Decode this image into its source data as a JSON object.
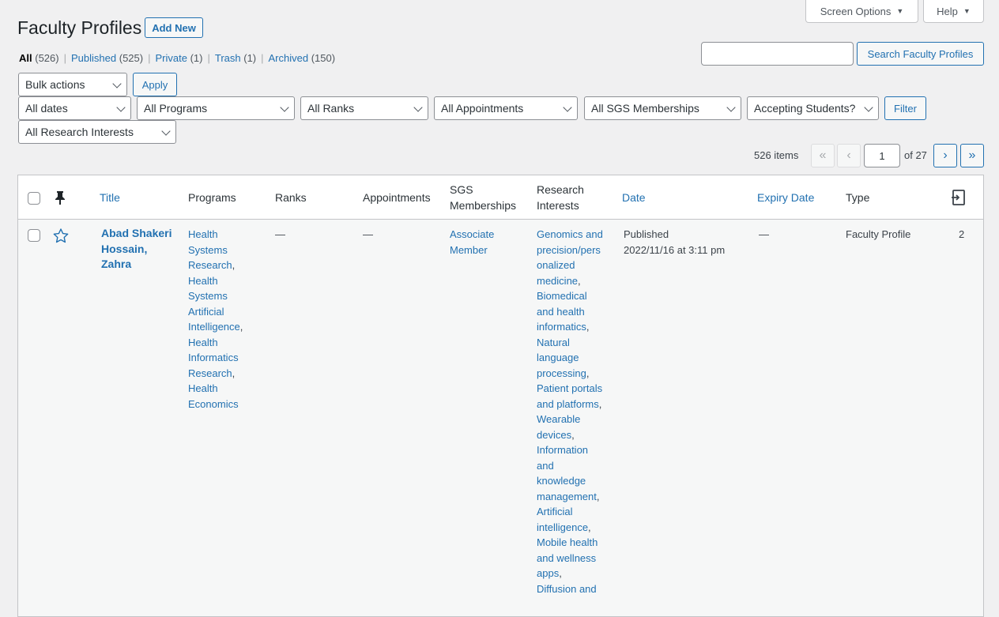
{
  "top_tabs": {
    "screen_options": "Screen Options",
    "help": "Help"
  },
  "header": {
    "title": "Faculty Profiles",
    "add_new": "Add New"
  },
  "views": {
    "all": {
      "label": "All",
      "count": "(526)"
    },
    "published": {
      "label": "Published",
      "count": "(525)"
    },
    "private": {
      "label": "Private",
      "count": "(1)"
    },
    "trash": {
      "label": "Trash",
      "count": "(1)"
    },
    "archived": {
      "label": "Archived",
      "count": "(150)"
    },
    "separator": "|"
  },
  "search": {
    "value": "",
    "button": "Search Faculty Profiles"
  },
  "bulk": {
    "selected": "Bulk actions",
    "apply": "Apply"
  },
  "filters": {
    "dates": "All dates",
    "programs": "All Programs",
    "ranks": "All Ranks",
    "appointments": "All Appointments",
    "sgs": "All SGS Memberships",
    "accepting": "Accepting Students?",
    "filter_button": "Filter",
    "research": "All Research Interests"
  },
  "pagination": {
    "items": "526 items",
    "first": "«",
    "prev": "‹",
    "current": "1",
    "of": "of 27",
    "next": "›",
    "last": "»"
  },
  "table": {
    "headers": {
      "title": "Title",
      "programs": "Programs",
      "ranks": "Ranks",
      "appointments": "Appointments",
      "sgs_1": "SGS",
      "sgs_2": "Memberships",
      "research_1": "Research",
      "research_2": "Interests",
      "date": "Date",
      "expiry": "Expiry Date",
      "type": "Type"
    },
    "rows": [
      {
        "title_lines": [
          "Abad Shakeri",
          "Hossain,",
          "Zahra"
        ],
        "programs_lines": [
          {
            "t": "Health",
            "c": ""
          },
          {
            "t": "Systems",
            "c": ""
          },
          {
            "t": "Research",
            "c": ","
          },
          {
            "t": "Health",
            "c": ""
          },
          {
            "t": "Systems",
            "c": ""
          },
          {
            "t": "Artificial",
            "c": ""
          },
          {
            "t": "Intelligence",
            "c": ","
          },
          {
            "t": "Health",
            "c": ""
          },
          {
            "t": "Informatics",
            "c": ""
          },
          {
            "t": "Research",
            "c": ","
          },
          {
            "t": "Health",
            "c": ""
          },
          {
            "t": "Economics",
            "c": ""
          }
        ],
        "ranks": "—",
        "appointments": "—",
        "sgs_lines": [
          "Associate",
          "Member"
        ],
        "research_lines": [
          {
            "t": "Genomics and",
            "c": ""
          },
          {
            "t": "precision/pers",
            "c": ""
          },
          {
            "t": "onalized",
            "c": ""
          },
          {
            "t": "medicine",
            "c": ","
          },
          {
            "t": "Biomedical",
            "c": ""
          },
          {
            "t": "and health",
            "c": ""
          },
          {
            "t": "informatics",
            "c": ","
          },
          {
            "t": "Natural",
            "c": ""
          },
          {
            "t": "language",
            "c": ""
          },
          {
            "t": "processing",
            "c": ","
          },
          {
            "t": "Patient portals",
            "c": ""
          },
          {
            "t": "and platforms",
            "c": ","
          },
          {
            "t": "Wearable",
            "c": ""
          },
          {
            "t": "devices",
            "c": ","
          },
          {
            "t": "Information",
            "c": ""
          },
          {
            "t": "and",
            "c": ""
          },
          {
            "t": "knowledge",
            "c": ""
          },
          {
            "t": "management",
            "c": ","
          },
          {
            "t": "Artificial",
            "c": ""
          },
          {
            "t": "intelligence",
            "c": ","
          },
          {
            "t": "Mobile health",
            "c": ""
          },
          {
            "t": "and wellness",
            "c": ""
          },
          {
            "t": "apps",
            "c": ","
          },
          {
            "t": "Diffusion and",
            "c": ""
          }
        ],
        "date_status": "Published",
        "date_value": "2022/11/16 at 3:11 pm",
        "expiry": "—",
        "type": "Faculty Profile",
        "revisions": "2"
      }
    ]
  },
  "icons": {
    "pin": "pin-icon",
    "star": "star-outline-icon",
    "revisions": "revisions-icon"
  },
  "colors": {
    "link": "#2271b1",
    "background": "#f0f0f1"
  }
}
